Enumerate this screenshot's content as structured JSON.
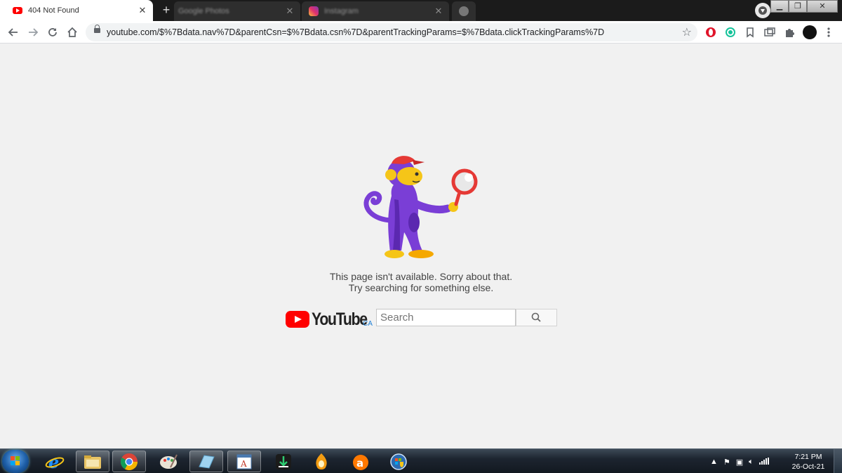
{
  "browser": {
    "tabs": [
      {
        "title": "404 Not Found",
        "active": true
      },
      {
        "title": "Google Photos",
        "active": false
      },
      {
        "title": "Instagram",
        "active": false
      }
    ],
    "new_tab_label": "+",
    "close_label": "✕",
    "url": "youtube.com/$%7Bdata.nav%7D&parentCsn=$%7Bdata.csn%7D&parentTrackingParams=$%7Bdata.clickTrackingParams%7D"
  },
  "page": {
    "message_line1": "This page isn't available. Sorry about that.",
    "message_line2": "Try searching for something else.",
    "logo_text": "YouTube",
    "logo_country": "CA",
    "search_placeholder": "Search"
  },
  "taskbar": {
    "time": "7:21 PM",
    "date": "26-Oct-21"
  },
  "colors": {
    "accent_red": "#ff0000",
    "page_bg": "#f1f1f1",
    "monkey_purple": "#7a3ed6",
    "monkey_yellow": "#f5c518"
  }
}
